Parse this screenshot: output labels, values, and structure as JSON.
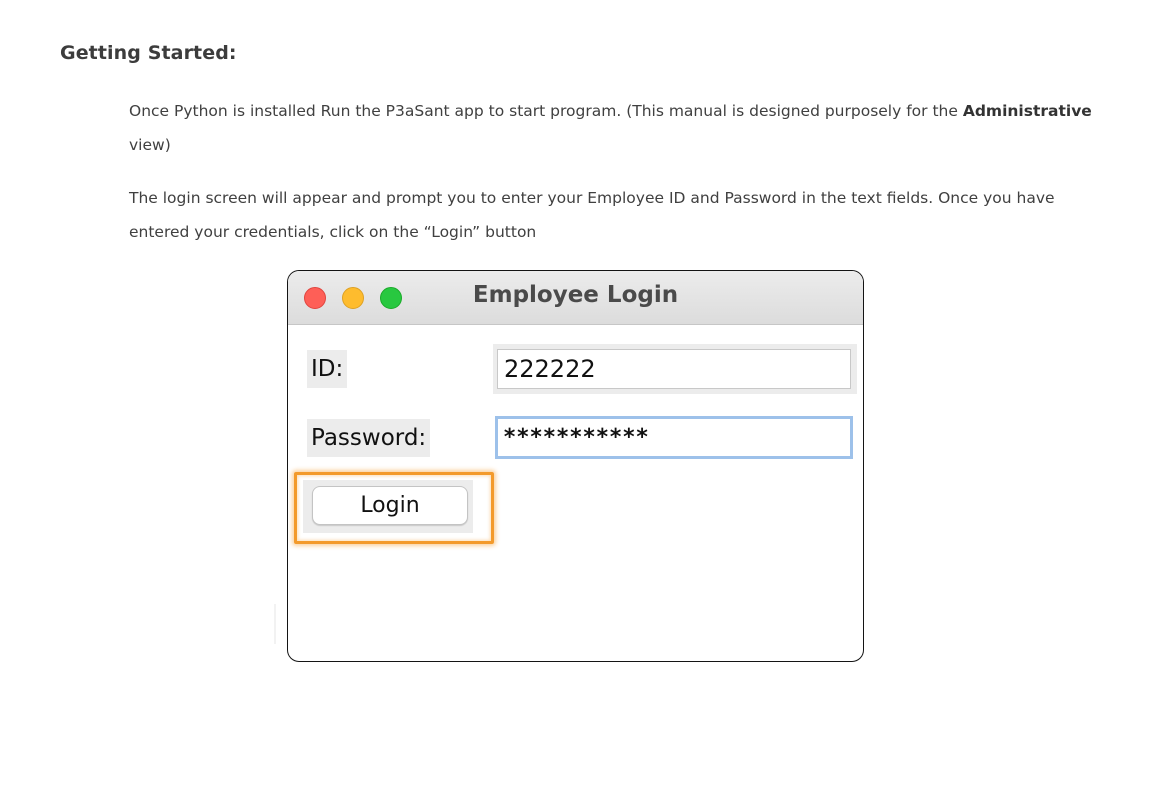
{
  "document": {
    "heading": "Getting Started:",
    "para1_text": "Once Python is installed Run the P3aSant app to start program. (This manual is designed purposely for the ",
    "para1_bold": "Administrative",
    "para1_end": " view)",
    "para2": "The login screen will appear and prompt you to enter your Employee ID and Password in the text fields. Once you have entered your credentials, click on the “Login” button"
  },
  "login_window": {
    "title": "Employee Login",
    "id_label": "ID:",
    "id_value": "222222",
    "password_label": "Password:",
    "password_value": "***********",
    "login_button": "Login",
    "traffic_colors": {
      "close": "#fe5f57",
      "minimize": "#febc2e",
      "maximize": "#28c840"
    },
    "highlight_color": "#f39a2b"
  }
}
